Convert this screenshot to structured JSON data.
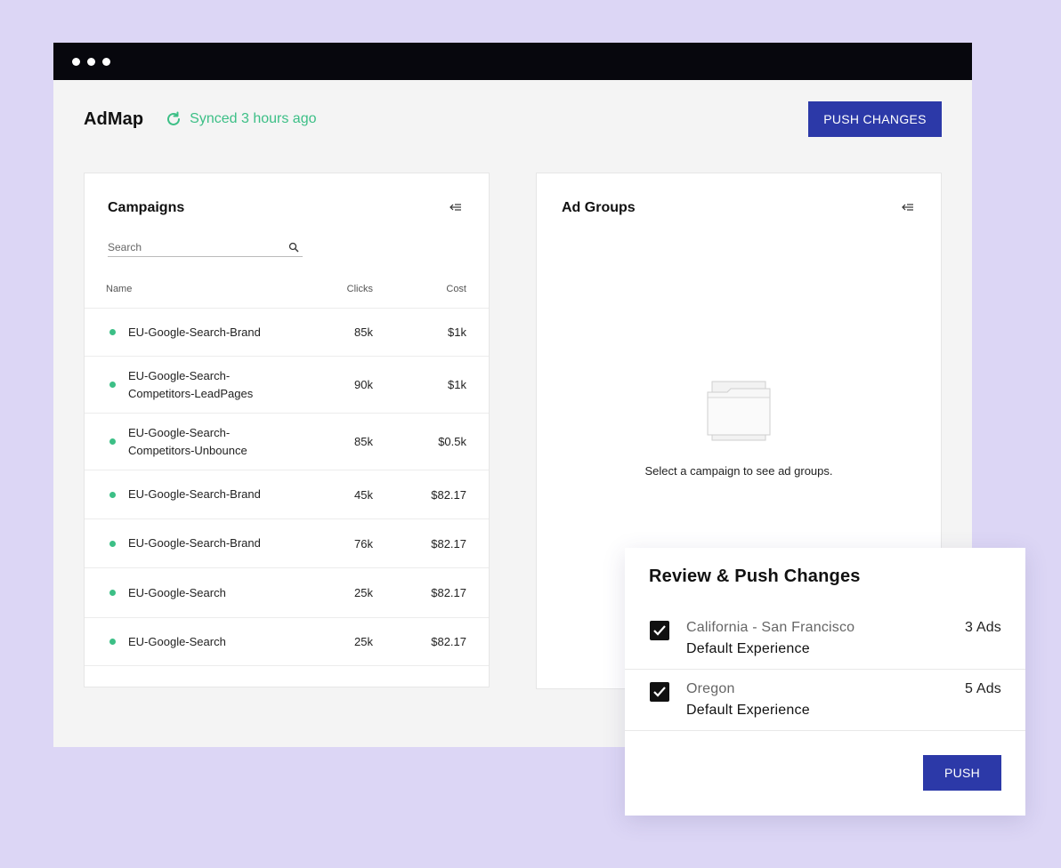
{
  "app": {
    "title": "AdMap",
    "sync_status": "Synced 3 hours ago",
    "push_changes_label": "PUSH CHANGES"
  },
  "campaigns": {
    "title": "Campaigns",
    "search_placeholder": "Search",
    "columns": {
      "name": "Name",
      "clicks": "Clicks",
      "cost": "Cost"
    },
    "rows": [
      {
        "name": "EU-Google-Search-Brand",
        "clicks": "85k",
        "cost": "$1k"
      },
      {
        "name": "EU-Google-Search-Competitors-LeadPages",
        "clicks": "90k",
        "cost": "$1k"
      },
      {
        "name": "EU-Google-Search-Competitors-Unbounce",
        "clicks": "85k",
        "cost": "$0.5k"
      },
      {
        "name": "EU-Google-Search-Brand",
        "clicks": "45k",
        "cost": "$82.17"
      },
      {
        "name": "EU-Google-Search-Brand",
        "clicks": "76k",
        "cost": "$82.17"
      },
      {
        "name": "EU-Google-Search",
        "clicks": "25k",
        "cost": "$82.17"
      },
      {
        "name": "EU-Google-Search",
        "clicks": "25k",
        "cost": "$82.17"
      }
    ]
  },
  "ad_groups": {
    "title": "Ad Groups",
    "empty_message": "Select a campaign to see ad groups."
  },
  "review": {
    "title": "Review & Push Changes",
    "items": [
      {
        "title": "California - San Francisco",
        "subtitle": "Default Experience",
        "count": "3 Ads",
        "checked": true
      },
      {
        "title": "Oregon",
        "subtitle": "Default Experience",
        "count": "5 Ads",
        "checked": true
      }
    ],
    "push_label": "PUSH"
  },
  "colors": {
    "background": "#dcd6f5",
    "accent": "#2c39a8",
    "success": "#3cbf86",
    "titlebar": "#07070d"
  }
}
